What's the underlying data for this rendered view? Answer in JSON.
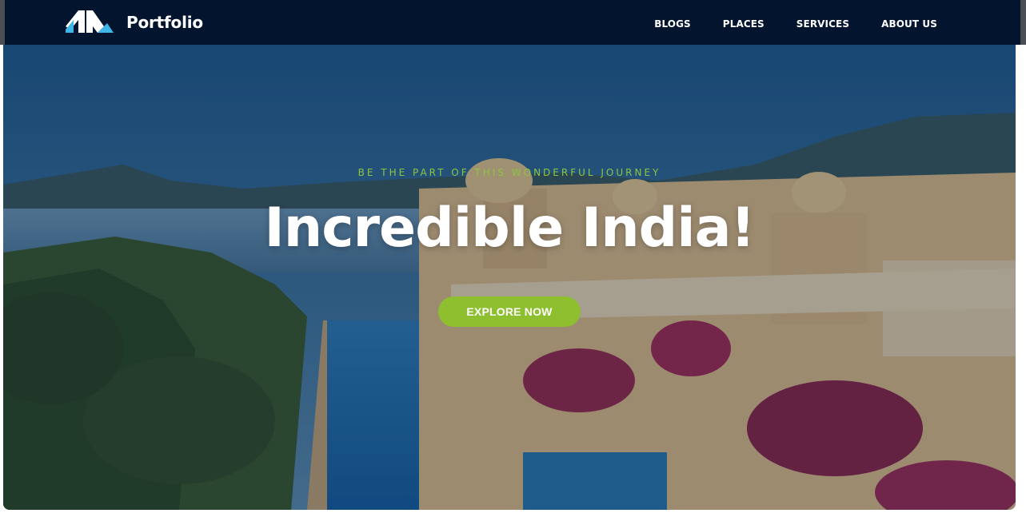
{
  "brand": {
    "name": "Portfolio",
    "logo_icon": "stylized-m-logo-icon",
    "colors": {
      "logo_primary": "#ffffff",
      "logo_accent": "#3fb6e8"
    }
  },
  "nav": {
    "items": [
      {
        "label": "BLOGS"
      },
      {
        "label": "PLACES"
      },
      {
        "label": "SERVICES"
      },
      {
        "label": "ABOUT US"
      }
    ]
  },
  "hero": {
    "kicker": "BE THE PART OF THIS WONDERFUL JOURNEY",
    "title": "Incredible India!",
    "cta_label": "EXPLORE NOW",
    "background": "palace-lake-hero-image"
  },
  "colors": {
    "nav_background": "#03142f",
    "accent_green": "#8dbf2f",
    "kicker_green": "#8cc63f",
    "text_white": "#ffffff"
  }
}
